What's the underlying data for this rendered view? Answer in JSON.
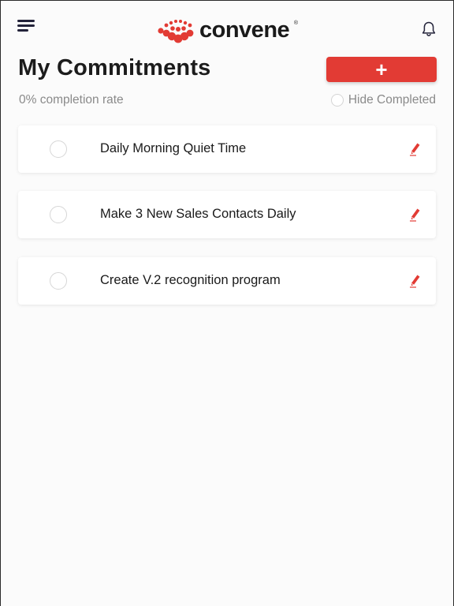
{
  "header": {
    "brand": "convene",
    "brand_mark": "®",
    "menu_icon": "hamburger-menu-icon",
    "bell_icon": "bell-icon",
    "accent": "#e23b34"
  },
  "page": {
    "title": "My Commitments",
    "add_label": "+",
    "completion_text": "0% completion rate",
    "hide_completed_label": "Hide Completed"
  },
  "commitments": [
    {
      "label": "Daily Morning Quiet Time",
      "completed": false
    },
    {
      "label": "Make 3 New Sales Contacts Daily",
      "completed": false
    },
    {
      "label": "Create V.2 recognition program",
      "completed": false
    }
  ]
}
